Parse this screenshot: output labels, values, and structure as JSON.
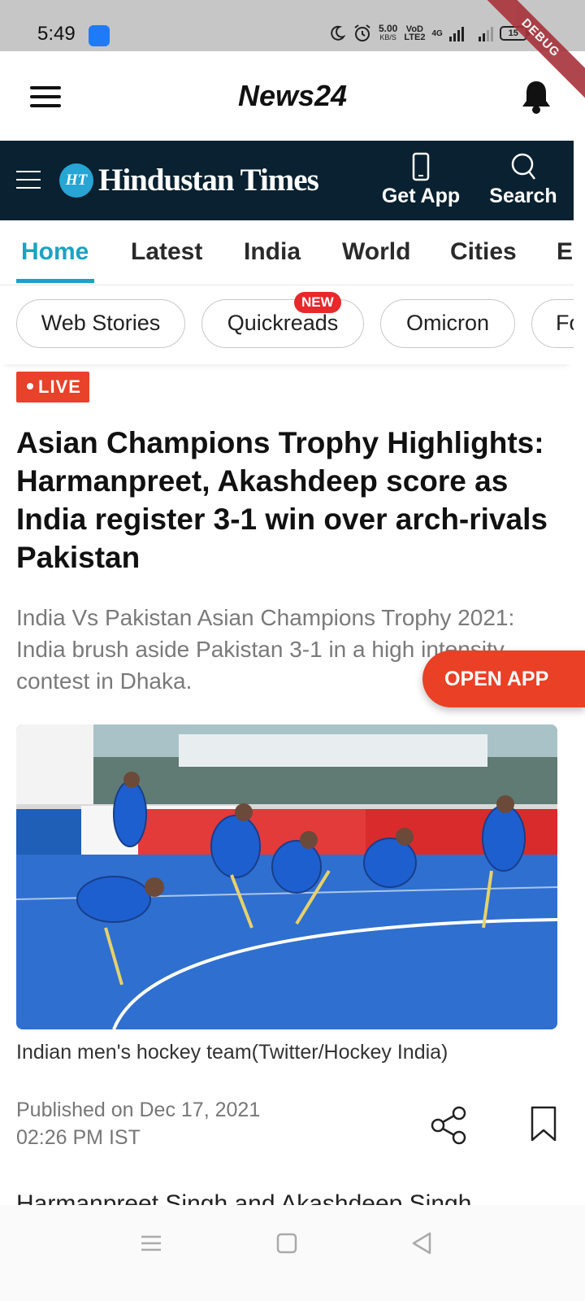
{
  "status_bar": {
    "time": "5:49",
    "speed_value": "5.00",
    "speed_unit": "KB/S",
    "volte_top": "VoD",
    "volte_bottom": "LTE2",
    "network": "4G",
    "battery": "15",
    "debug_label": "DEBUG"
  },
  "app_bar": {
    "title": "News24"
  },
  "ht_header": {
    "logo_mark": "HT",
    "logo_text": "Hindustan Times",
    "get_app_label": "Get App",
    "search_label": "Search"
  },
  "nav_tabs": [
    {
      "label": "Home",
      "active": true
    },
    {
      "label": "Latest"
    },
    {
      "label": "India"
    },
    {
      "label": "World"
    },
    {
      "label": "Cities"
    },
    {
      "label": "Er"
    }
  ],
  "chips": [
    {
      "label": "Web Stories"
    },
    {
      "label": "Quickreads",
      "badge": "NEW"
    },
    {
      "label": "Omicron"
    },
    {
      "label": "Fo"
    }
  ],
  "article": {
    "live_label": "LIVE",
    "headline": "Asian Champions Trophy Highlights: Harmanpreet, Akashdeep score as India register 3-1 win over arch-rivals Pakistan",
    "summary": "India Vs Pakistan Asian Champions Trophy 2021: India brush aside Pakistan 3-1 in a high intensity contest in Dhaka.",
    "image_caption": "Indian men's hockey team(Twitter/Hockey India)",
    "published_line1": "Published on Dec 17, 2021",
    "published_line2": "02:26 PM IST",
    "next_paragraph_peek": "Harmanpreet Singh and Akashdeep Singh"
  },
  "open_app_label": "OPEN APP",
  "colors": {
    "accent_teal": "#1aa3c4",
    "ht_navy": "#092130",
    "live_red": "#e8422a",
    "open_app_red": "#ea4025",
    "pitch_blue": "#2a6fd6"
  },
  "icons": [
    "hamburger-icon",
    "bell-icon",
    "ht-menu-icon",
    "phone-icon",
    "search-icon",
    "share-icon",
    "bookmark-icon",
    "recents-icon",
    "home-icon",
    "back-icon"
  ]
}
